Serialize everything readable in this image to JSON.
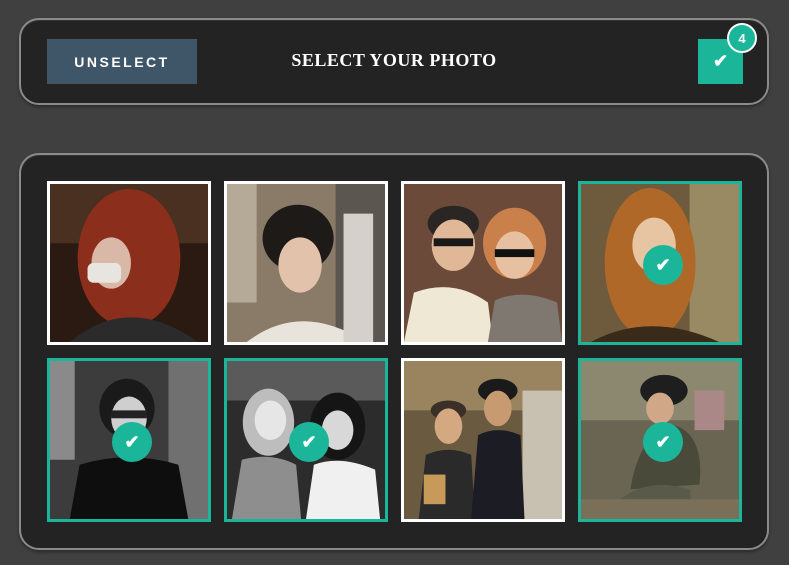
{
  "header": {
    "unselect_label": "UNSELECT",
    "title": "SELECT YOUR PHOTO",
    "confirm_icon": "check-icon",
    "selected_count": "4"
  },
  "colors": {
    "accent": "#1bb69a",
    "unselect_bg": "#3f5668",
    "panel_bg": "#232323",
    "page_bg": "#404040"
  },
  "photos": [
    {
      "subject": "red-haired woman with face mask",
      "selected": false
    },
    {
      "subject": "woman with dark bob haircut",
      "selected": false
    },
    {
      "subject": "couple in sunglasses and glasses",
      "selected": false
    },
    {
      "subject": "woman with long auburn hair",
      "selected": true
    },
    {
      "subject": "woman with glasses black and white",
      "selected": true
    },
    {
      "subject": "two women black and white street",
      "selected": true
    },
    {
      "subject": "two men in hats on street",
      "selected": false
    },
    {
      "subject": "person crouching in fur hat",
      "selected": true
    }
  ]
}
